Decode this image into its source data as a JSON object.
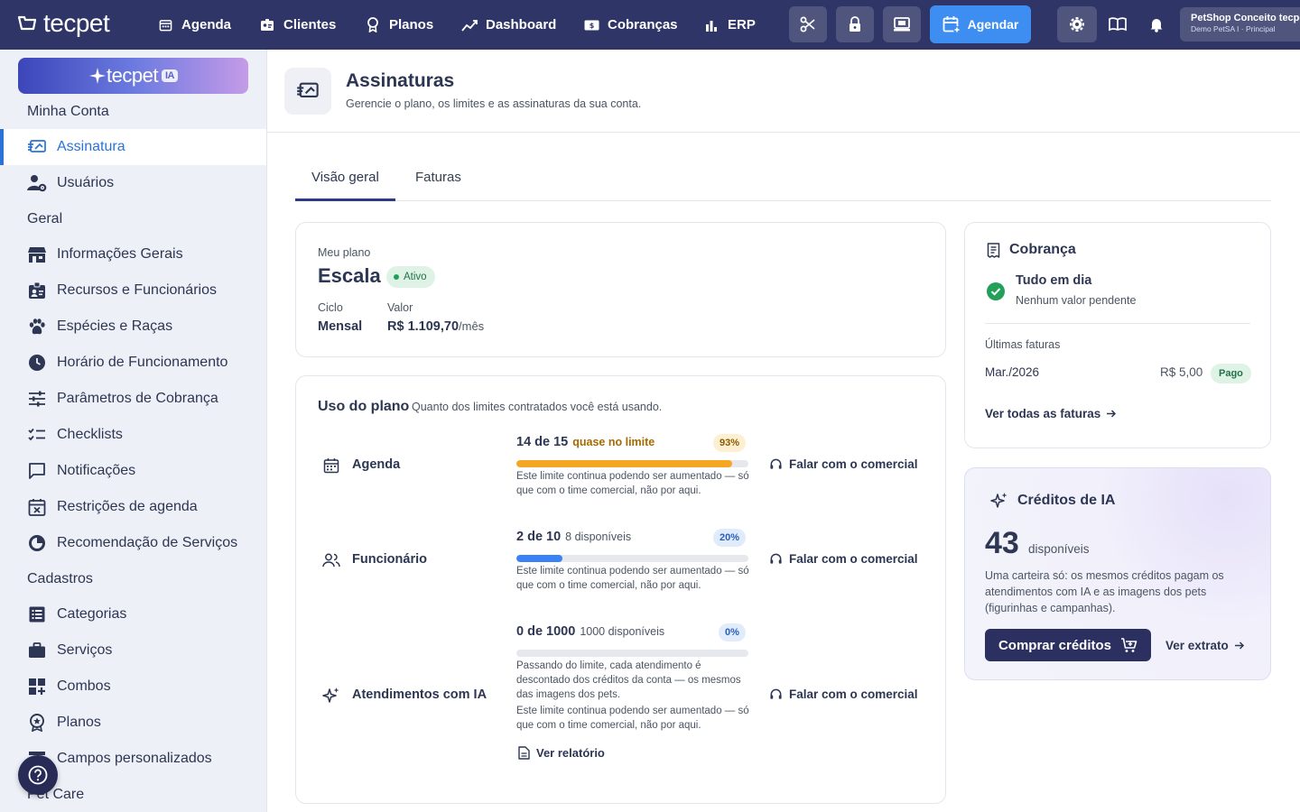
{
  "topbar": {
    "logo": "tecpet",
    "nav": [
      {
        "label": "Agenda",
        "icon": "calendar-icon"
      },
      {
        "label": "Clientes",
        "icon": "contacts-icon"
      },
      {
        "label": "Planos",
        "icon": "award-icon"
      },
      {
        "label": "Dashboard",
        "icon": "chart-trend-icon"
      },
      {
        "label": "Cobranças",
        "icon": "money-icon"
      },
      {
        "label": "ERP",
        "icon": "bar-chart-icon"
      }
    ],
    "agendar_label": "Agendar",
    "account": {
      "name": "PetShop Conceito tecpet",
      "sub": "Demo PetSA I · Principal"
    }
  },
  "sidebar": {
    "ia_banner": {
      "text": "tecpet",
      "badge": "IA"
    },
    "sections": [
      {
        "title": "Minha Conta",
        "items": [
          {
            "label": "Assinatura",
            "icon": "subscription-icon",
            "active": true
          },
          {
            "label": "Usuários",
            "icon": "users-gear-icon"
          }
        ]
      },
      {
        "title": "Geral",
        "items": [
          {
            "label": "Informações Gerais",
            "icon": "store-icon"
          },
          {
            "label": "Recursos e Funcionários",
            "icon": "badge-icon"
          },
          {
            "label": "Espécies e Raças",
            "icon": "paw-icon"
          },
          {
            "label": "Horário de Funcionamento",
            "icon": "clock-icon"
          },
          {
            "label": "Parâmetros de Cobrança",
            "icon": "sliders-icon"
          },
          {
            "label": "Checklists",
            "icon": "checklist-icon"
          },
          {
            "label": "Notificações",
            "icon": "chat-icon"
          },
          {
            "label": "Restrições de agenda",
            "icon": "calendar-x-icon"
          },
          {
            "label": "Recomendação de Serviços",
            "icon": "recommend-icon"
          }
        ]
      },
      {
        "title": "Cadastros",
        "items": [
          {
            "label": "Categorias",
            "icon": "list-icon"
          },
          {
            "label": "Serviços",
            "icon": "briefcase-icon"
          },
          {
            "label": "Combos",
            "icon": "grid-plus-icon"
          },
          {
            "label": "Planos",
            "icon": "award-icon"
          },
          {
            "label": "Campos personalizados",
            "icon": "fields-icon"
          }
        ]
      },
      {
        "title": "Pet Care",
        "items": []
      }
    ]
  },
  "header": {
    "title": "Assinaturas",
    "subtitle": "Gerencie o plano, os limites e as assinaturas da sua conta."
  },
  "tabs": [
    {
      "label": "Visão geral",
      "active": true
    },
    {
      "label": "Faturas",
      "active": false
    }
  ],
  "plan": {
    "label": "Meu plano",
    "name": "Escala",
    "status": "Ativo",
    "cycle_label": "Ciclo",
    "cycle": "Mensal",
    "value_label": "Valor",
    "value": "R$ 1.109,70",
    "per": "/mês"
  },
  "usage": {
    "title": "Uso do plano",
    "subtitle": "Quanto dos limites contratados você está usando.",
    "contact_label": "Falar com o comercial",
    "report_label": "Ver relatório",
    "rows": [
      {
        "name": "Agenda",
        "count": "14 de 15",
        "status": "quase no limite",
        "percent_label": "93%",
        "percent": 93,
        "note": "Este limite continua podendo ser aumentado — só que com o time comercial, não por aqui."
      },
      {
        "name": "Funcionário",
        "count": "2 de 10",
        "status": "8 disponíveis",
        "percent_label": "20%",
        "percent": 20,
        "note": "Este limite continua podendo ser aumentado — só que com o time comercial, não por aqui."
      },
      {
        "name": "Atendimentos com IA",
        "count": "0 de 1000",
        "status": "1000 disponíveis",
        "percent_label": "0%",
        "percent": 0,
        "note_extra": "Passando do limite, cada atendimento é descontado dos créditos da conta — os mesmos das imagens dos pets.",
        "note": "Este limite continua podendo ser aumentado — só que com o time comercial, não por aqui."
      }
    ]
  },
  "billing": {
    "title": "Cobrança",
    "status_title": "Tudo em dia",
    "status_sub": "Nenhum valor pendente",
    "invoices_label": "Últimas faturas",
    "invoices": [
      {
        "month": "Mar./2026",
        "value": "R$ 5,00",
        "status": "Pago"
      }
    ],
    "view_all": "Ver todas as faturas"
  },
  "ia_credits": {
    "title": "Créditos de IA",
    "amount": "43",
    "amount_label": "disponíveis",
    "description": "Uma carteira só: os mesmos créditos pagam os atendimentos com IA e as imagens dos pets (figurinhas e campanhas).",
    "buy_label": "Comprar créditos",
    "statement_label": "Ver extrato"
  },
  "colors": {
    "navbar": "#2f3566",
    "accent": "#2a73d9",
    "agendar": "#3d8ef0",
    "warning": "#f5a623",
    "progress": "#3b82f6"
  }
}
